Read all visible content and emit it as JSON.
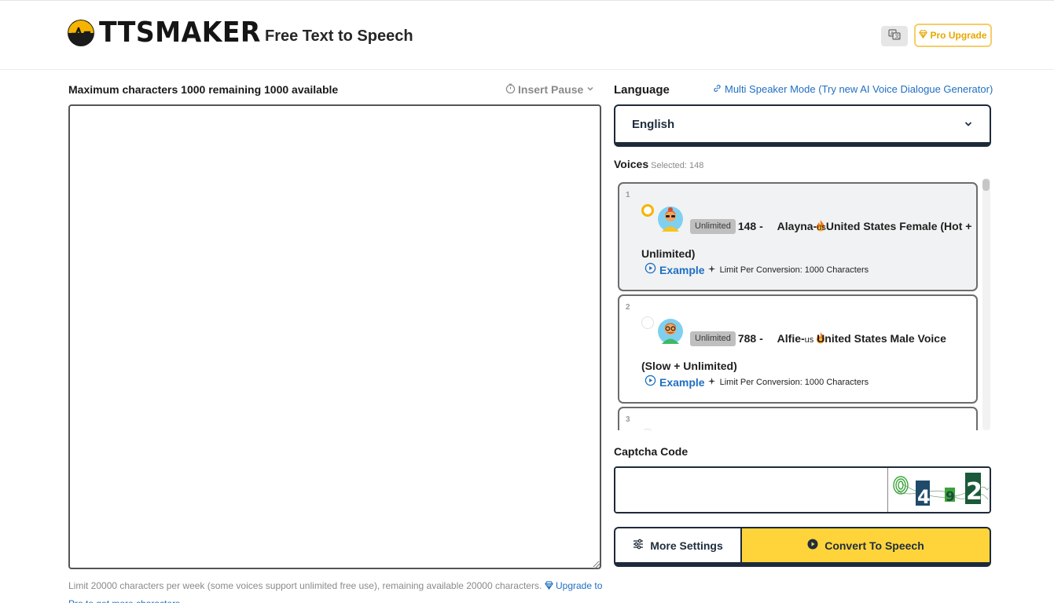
{
  "header": {
    "logo_text": "TTSMAKER",
    "tagline": "Free Text to Speech",
    "translate_icon": "translate-icon",
    "pro_upgrade_label": "Pro Upgrade",
    "pro_upgrade_icon": "diamond-icon"
  },
  "editor": {
    "char_info": "Maximum characters 1000 remaining 1000 available",
    "insert_pause_label": "Insert Pause",
    "text_value": "",
    "limit_note": "Limit 20000 characters per week (some voices support unlimited free use), remaining available 20000 characters.",
    "upgrade_link": "Upgrade to Pro to get more characters"
  },
  "language": {
    "label": "Language",
    "multi_speaker_link": "Multi Speaker Mode (Try new AI Voice Dialogue Generator)",
    "selected": "English"
  },
  "voices": {
    "label": "Voices",
    "selected_info": "Selected: 148",
    "items": [
      {
        "index": "1",
        "badge": "Unlimited",
        "id_prefix": "148 - ",
        "name": "Alayna-",
        "country_code": "us",
        "description": "United States Female (Hot + Unlimited)",
        "example_label": "Example",
        "limit": "Limit Per Conversion: 1000 Characters",
        "selected": true
      },
      {
        "index": "2",
        "badge": "Unlimited",
        "id_prefix": "788 - ",
        "name": "Alfie-",
        "country_code": "us",
        "description": " United States Male Voice (Slow + Unlimited)",
        "example_label": "Example",
        "limit": "Limit Per Conversion: 1000 Characters",
        "selected": false
      },
      {
        "index": "3"
      }
    ]
  },
  "captcha": {
    "label": "Captcha Code",
    "value": "",
    "image_text": "0 4 9 2"
  },
  "actions": {
    "more_settings_label": "More Settings",
    "convert_label": "Convert To Speech"
  },
  "colors": {
    "accent_yellow": "#ffd43b",
    "link_blue": "#1e6fc2",
    "border_dark": "#1d2a3a",
    "pro_gold": "#e8a800"
  }
}
